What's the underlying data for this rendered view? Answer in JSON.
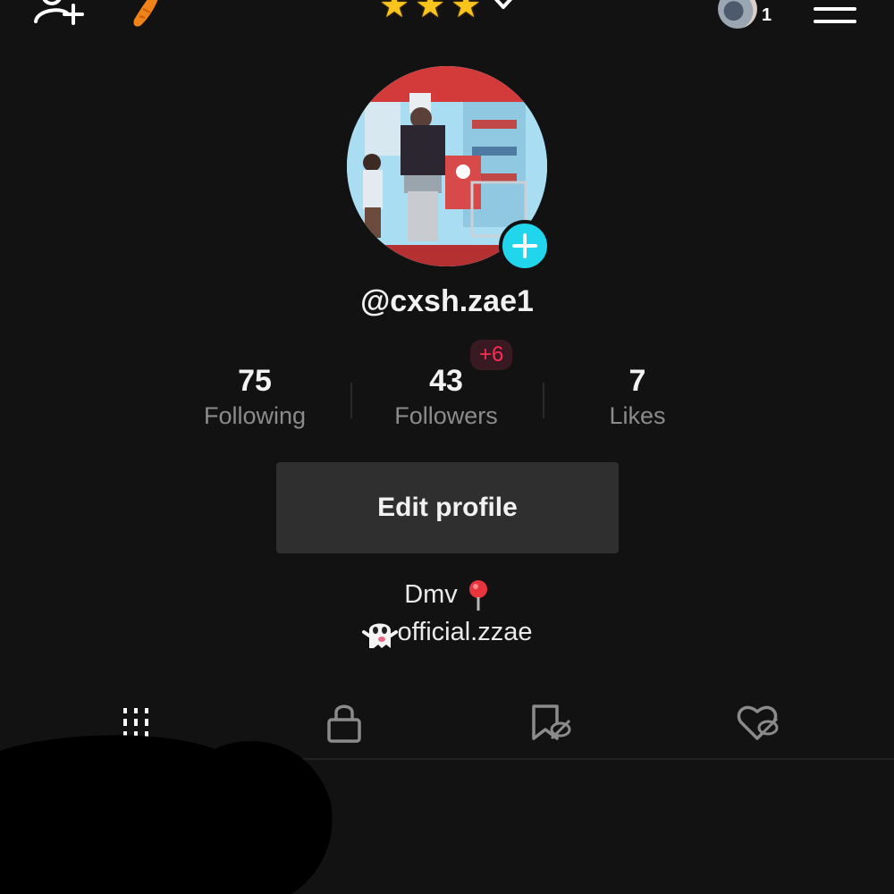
{
  "profile": {
    "username": "@cxsh.zae1",
    "stats": [
      {
        "value": "75",
        "label": "Following"
      },
      {
        "value": "43",
        "label": "Followers"
      },
      {
        "value": "7",
        "label": "Likes"
      }
    ],
    "new_followers_badge": "+6",
    "edit_button_label": "Edit profile",
    "bio_line1": "Dmv",
    "bio_line2": "official.zzae"
  },
  "header": {
    "notification_count": "1",
    "star_icons": [
      "star-icon",
      "star-icon",
      "star-icon"
    ]
  },
  "tabs": [
    {
      "icon": "videos-grid-icon"
    },
    {
      "icon": "lock-icon"
    },
    {
      "icon": "favorites-hidden-icon"
    },
    {
      "icon": "liked-hidden-icon"
    }
  ],
  "colors": {
    "background": "#121212",
    "accent_cyan": "#20d5ec",
    "badge_red": "#fe2c55",
    "button_bg": "#2f2f2f"
  }
}
